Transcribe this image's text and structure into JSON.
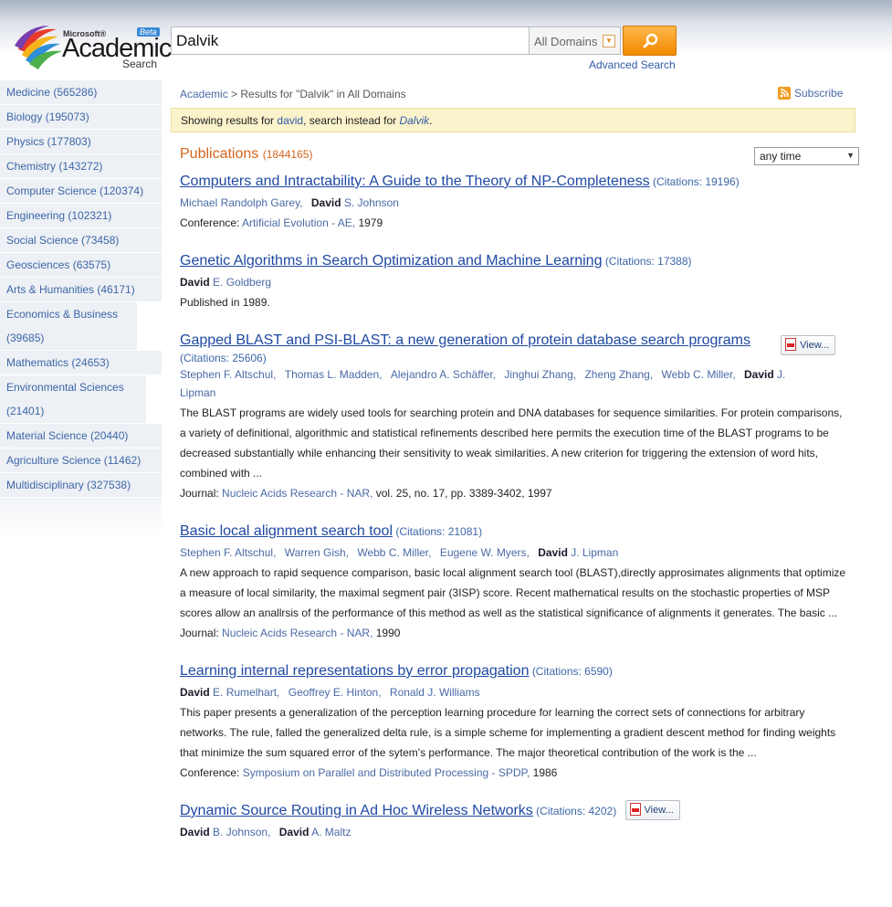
{
  "header": {
    "logo": {
      "ms": "Microsoft®",
      "academic": "Academic",
      "search": "Search",
      "beta": "Beta"
    },
    "search_value": "Dalvik",
    "domain_select": "All Domains",
    "advanced_search": "Advanced Search",
    "colors": {
      "search_button": "#f08a00",
      "accent_orange": "#d5641b"
    }
  },
  "sidebar": {
    "items": [
      {
        "label": "Medicine (565286)"
      },
      {
        "label": "Biology (195073)"
      },
      {
        "label": "Physics (177803)"
      },
      {
        "label": "Chemistry (143272)"
      },
      {
        "label": "Computer Science (120374)"
      },
      {
        "label": "Engineering (102321)"
      },
      {
        "label": "Social Science (73458)"
      },
      {
        "label": "Geosciences (63575)"
      },
      {
        "label": "Arts & Humanities (46171)"
      },
      {
        "label": "Economics & Business (39685)"
      },
      {
        "label": "Mathematics (24653)"
      },
      {
        "label": "Environmental Sciences (21401)"
      },
      {
        "label": "Material Science (20440)"
      },
      {
        "label": "Agriculture Science (11462)"
      },
      {
        "label": "Multidisciplinary (327538)"
      }
    ]
  },
  "breadcrumb": {
    "root": "Academic",
    "separator": ">",
    "current": "Results for \"Dalvik\" in All Domains"
  },
  "subscribe": "Subscribe",
  "notice": {
    "prefix": "Showing results for ",
    "suggested": "david",
    "middle": ", search instead for ",
    "original": "Dalvik",
    "suffix": "."
  },
  "publications": {
    "heading": "Publications",
    "count": "(1844165)",
    "time_filter": "any time"
  },
  "view_label": "View...",
  "results": [
    {
      "title": "Computers and Intractability: A Guide to the Theory of NP-Completeness",
      "citations": "(Citations: 19196)",
      "venue_type": "Conference: ",
      "venue": "Artificial Evolution - AE,",
      "venue_rest": " 1979"
    },
    {
      "title": "Genetic Algorithms in Search Optimization and Machine Learning",
      "citations": "(Citations: 17388)",
      "published": "Published in 1989."
    },
    {
      "title": "Gapped BLAST and PSI-BLAST: a new generation of protein database search programs",
      "citations": "(Citations: 25606)",
      "abstract": "The BLAST programs are widely used tools for searching protein and DNA databases for sequence similarities. For protein comparisons, a variety of definitional, algorithmic and statistical refinements described here permits the execution time of the BLAST programs to be decreased substantially while enhancing their sensitivity to weak similarities. A new criterion for triggering the extension of word hits, combined with ...",
      "venue_type": "Journal: ",
      "venue": "Nucleic Acids Research - NAR,",
      "venue_rest": " vol. 25, no. 17, pp. 3389-3402, 1997"
    },
    {
      "title": "Basic local alignment search tool",
      "citations": "(Citations: 21081)",
      "abstract": "A new approach to rapid sequence comparison, basic local alignment search tool (BLAST),directly approsimates alignments that optimize a measure of local similarity, the maximal segment pair (3ISP) score. Recent mathematical results on the stochastic properties of MSP scores allow an anallrsis of the performance of this method as well as the statistical significance of alignments it generates. The basic ...",
      "venue_type": "Journal: ",
      "venue": "Nucleic Acids Research - NAR,",
      "venue_rest": " 1990"
    },
    {
      "title": "Learning internal representations by error propagation",
      "citations": "(Citations: 6590)",
      "abstract": "This paper presents a generalization of the perception learning procedure for learning the correct sets of connections for arbitrary networks. The rule, falled the generalized delta rule, is a simple scheme for implementing a gradient descent method for finding weights that minimize the sum squared error of the sytem's performance. The major theoretical contribution of the work is the ...",
      "venue_type": "Conference: ",
      "venue": "Symposium on Parallel and Distributed Processing - SPDP,",
      "venue_rest": " 1986"
    },
    {
      "title": "Dynamic Source Routing in Ad Hoc Wireless Networks",
      "citations": "(Citations: 4202)"
    }
  ],
  "authors": {
    "r0": [
      {
        "first": "",
        "rest": "Michael Randolph Garey,"
      },
      {
        "first": "David",
        "rest": " S. Johnson"
      }
    ],
    "r1": [
      {
        "first": "David",
        "rest": " E. Goldberg"
      }
    ],
    "r2": [
      {
        "first": "",
        "rest": "Stephen F. Altschul,"
      },
      {
        "first": "",
        "rest": "Thomas L. Madden,"
      },
      {
        "first": "",
        "rest": "Alejandro A. Schäffer,"
      },
      {
        "first": "",
        "rest": "Jinghui Zhang,"
      },
      {
        "first": "",
        "rest": "Zheng Zhang,"
      },
      {
        "first": "",
        "rest": "Webb C. Miller,"
      },
      {
        "first": "David",
        "rest": " J."
      }
    ],
    "r2_cont": "Lipman",
    "r3": [
      {
        "first": "",
        "rest": "Stephen F. Altschul,"
      },
      {
        "first": "",
        "rest": "Warren Gish,"
      },
      {
        "first": "",
        "rest": "Webb C. Miller,"
      },
      {
        "first": "",
        "rest": "Eugene W. Myers,"
      },
      {
        "first": "David",
        "rest": " J. Lipman"
      }
    ],
    "r4": [
      {
        "first": "David",
        "rest": " E. Rumelhart,"
      },
      {
        "first": "",
        "rest": "Geoffrey E. Hinton,"
      },
      {
        "first": "",
        "rest": "Ronald J. Williams"
      }
    ],
    "r5": [
      {
        "first": "David",
        "rest": " B. Johnson,"
      },
      {
        "first": "David",
        "rest": " A. Maltz"
      }
    ]
  }
}
